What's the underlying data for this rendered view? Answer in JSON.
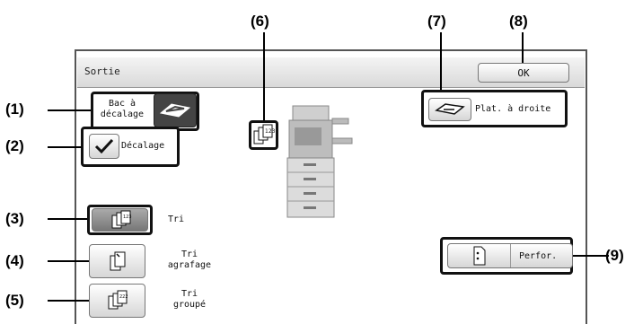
{
  "dialog": {
    "title": "Sortie",
    "ok_label": "OK"
  },
  "controls": {
    "offset_tray_label_line1": "Bac à",
    "offset_tray_label_line2": "décalage",
    "offset_label": "Décalage",
    "right_tray_label": "Plat. à droite",
    "sort_label": "Tri",
    "staple_sort_line1": "Tri",
    "staple_sort_line2": "agrafage",
    "group_line1": "Tri",
    "group_line2": "groupé",
    "punch_label": "Perfor."
  },
  "callouts": [
    "(1)",
    "(2)",
    "(3)",
    "(4)",
    "(5)",
    "(6)",
    "(7)",
    "(8)",
    "(9)"
  ],
  "icons": [
    "offset-tray-icon",
    "checkmark-icon",
    "right-tray-icon",
    "sort-icon",
    "staple-sort-icon",
    "group-icon",
    "punch-icon",
    "machine-icon",
    "output-status-icon"
  ]
}
